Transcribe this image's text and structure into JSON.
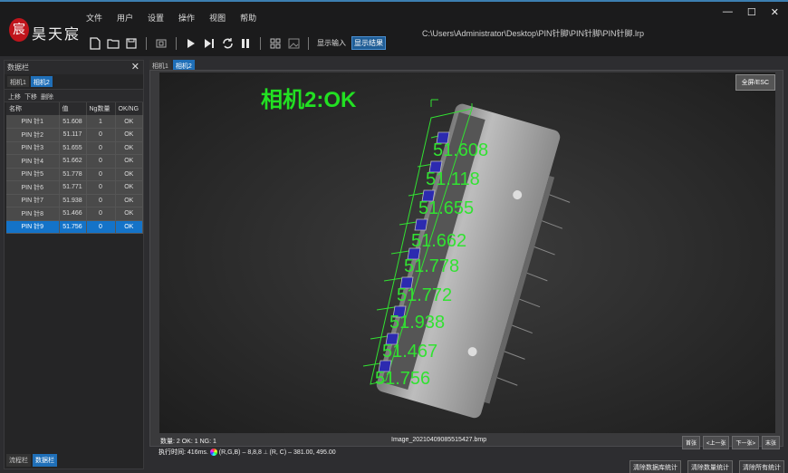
{
  "brand": {
    "name": "昊天宸",
    "logo_char": "宸"
  },
  "menu": [
    "文件",
    "用户",
    "设置",
    "操作",
    "视图",
    "帮助"
  ],
  "toolbar": {
    "show_input_label": "显示输入",
    "show_result_label": "显示结果"
  },
  "file_path": "C:\\Users\\Administrator\\Desktop\\PIN针脚\\PIN针脚\\PIN针脚.lrp",
  "window_controls": {
    "minimize": "—",
    "maximize": "☐",
    "close": "✕"
  },
  "left_panel": {
    "title": "数据栏",
    "close": "✕",
    "tabs": [
      "相机1",
      "相机2"
    ],
    "ops": [
      "上移",
      "下移",
      "删除"
    ],
    "columns": [
      "名称",
      "值",
      "Ng数量",
      "OK/NG"
    ],
    "rows": [
      {
        "name": "PIN 针1",
        "value": "51.608",
        "ng": "1",
        "status": "OK"
      },
      {
        "name": "PIN 针2",
        "value": "51.117",
        "ng": "0",
        "status": "OK"
      },
      {
        "name": "PIN 针3",
        "value": "51.655",
        "ng": "0",
        "status": "OK"
      },
      {
        "name": "PIN 针4",
        "value": "51.662",
        "ng": "0",
        "status": "OK"
      },
      {
        "name": "PIN 针5",
        "value": "51.778",
        "ng": "0",
        "status": "OK"
      },
      {
        "name": "PIN 针6",
        "value": "51.771",
        "ng": "0",
        "status": "OK"
      },
      {
        "name": "PIN 针7",
        "value": "51.938",
        "ng": "0",
        "status": "OK"
      },
      {
        "name": "PIN 针8",
        "value": "51.466",
        "ng": "0",
        "status": "OK"
      },
      {
        "name": "PIN 针9",
        "value": "51.756",
        "ng": "0",
        "status": "OK"
      }
    ],
    "bottom_tabs": [
      "流程栏",
      "数据栏"
    ]
  },
  "camera_tabs": [
    "相机1",
    "相机2"
  ],
  "viewer": {
    "fullscreen_label": "全屏/ESC",
    "result_text": "相机2:OK",
    "measurements": [
      "51.608",
      "51.118",
      "51.655",
      "51.662",
      "51.778",
      "51.772",
      "51.938",
      "51.467",
      "51.756"
    ]
  },
  "status": {
    "stats": "数量: 2 OK: 1 NG: 1",
    "filename": "Image_20210409085515427.bmp",
    "nav": [
      "首张",
      "<上一张",
      "下一张>",
      "末张"
    ],
    "exec_label": "执行时间:",
    "exec_time": "416ms.",
    "rgb_label": "(R,G,B)",
    "rgb_value": "8,8,8",
    "rc_label": "(R, C)",
    "rc_value": "381.00, 495.00"
  },
  "bottom_buttons": [
    "清除数据库统计",
    "清除数量统计",
    "清除所有统计"
  ],
  "colors": {
    "accent": "#1473c8",
    "overlay_green": "#32e232"
  }
}
